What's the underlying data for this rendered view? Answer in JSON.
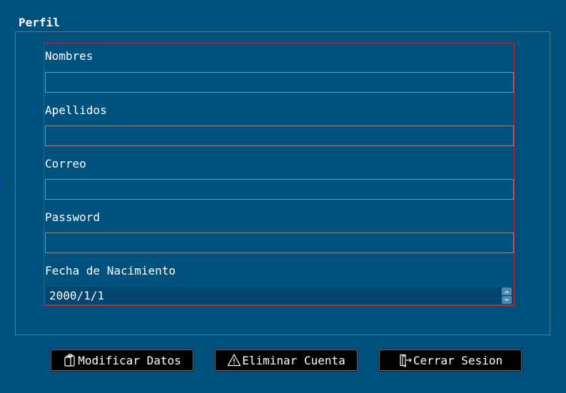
{
  "profile": {
    "title": "Perfil",
    "fields": [
      {
        "label": "Nombres",
        "value": ""
      },
      {
        "label": "Apellidos",
        "value": ""
      },
      {
        "label": "Correo",
        "value": ""
      },
      {
        "label": "Password",
        "value": ""
      }
    ],
    "birthdate": {
      "label": "Fecha de Nacimiento",
      "value": "2000/1/1"
    }
  },
  "actions": {
    "modify_label": "Modificar Datos",
    "modify_icon": "clipboard-icon",
    "delete_label": "Eliminar Cuenta",
    "delete_icon": "warning-icon",
    "logout_label": "Cerrar Sesion",
    "logout_icon": "logout-icon"
  },
  "colors": {
    "background": "#01517f",
    "panel_border": "#c0283a",
    "button_bg": "#000000"
  }
}
